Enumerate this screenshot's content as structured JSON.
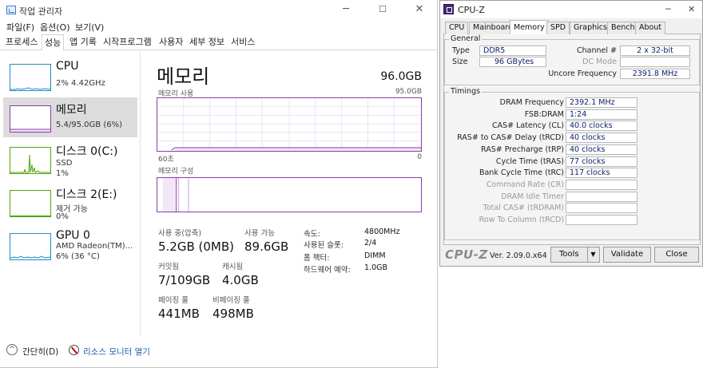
{
  "taskmgr": {
    "title": "작업 관리자",
    "window_controls": [
      "─",
      "☐",
      "✕"
    ],
    "menu": [
      "파일(F)",
      "옵션(O)",
      "보기(V)"
    ],
    "tabs": [
      "프로세스",
      "성능",
      "앱 기록",
      "시작프로그램",
      "사용자",
      "세부 정보",
      "서비스"
    ],
    "active_tab": "성능",
    "sidebar": [
      {
        "name": "CPU",
        "sub1": "2% 4.42GHz",
        "color": "#1e8bc3"
      },
      {
        "name": "메모리",
        "sub1": "5.4/95.0GB (6%)",
        "color": "#8b3ca8"
      },
      {
        "name": "디스크 0(C:)",
        "sub1": "SSD",
        "sub2": "1%",
        "color": "#4da60c"
      },
      {
        "name": "디스크 2(E:)",
        "sub1": "제거 가능",
        "sub2": "0%",
        "color": "#4da60c"
      },
      {
        "name": "GPU 0",
        "sub1": "AMD Radeon(TM)...",
        "sub2": "6% (36 °C)",
        "color": "#1e8bc3"
      }
    ],
    "main": {
      "title": "메모리",
      "total": "96.0GB",
      "usage_label": "메모리 사용",
      "usage_max": "95.0GB",
      "time_label": "60초",
      "zero": "0",
      "composition_label": "메모리 구성",
      "usage_fraction": 0.06,
      "stats": {
        "in_use_label": "사용 중(압축)",
        "in_use_value": "5.2GB (0MB)",
        "available_label": "사용 가능",
        "available_value": "89.6GB",
        "committed_label": "커밋됨",
        "committed_value": "7/109GB",
        "cached_label": "캐시됨",
        "cached_value": "4.0GB",
        "paged_label": "페이징 풀",
        "paged_value": "441MB",
        "nonpaged_label": "비페이징 풀",
        "nonpaged_value": "498MB"
      },
      "details": [
        {
          "label": "속도:",
          "value": "4800MHz"
        },
        {
          "label": "사용된 슬롯:",
          "value": "2/4"
        },
        {
          "label": "폼 팩터:",
          "value": "DIMM"
        },
        {
          "label": "하드웨어 예약:",
          "value": "1.0GB"
        }
      ]
    },
    "footer": {
      "less": "간단히(D)",
      "monitor": "리소스 모니터 열기"
    }
  },
  "cpuz": {
    "title": "CPU-Z",
    "window_controls": [
      "─",
      "✕"
    ],
    "tabs": [
      "CPU",
      "Mainboard",
      "Memory",
      "SPD",
      "Graphics",
      "Bench",
      "About"
    ],
    "active_tab": "Memory",
    "general": {
      "title": "General",
      "type_label": "Type",
      "type_value": "DDR5",
      "size_label": "Size",
      "size_value": "96 GBytes",
      "channel_label": "Channel #",
      "channel_value": "2 x 32-bit",
      "dcmode_label": "DC Mode",
      "dcmode_value": "",
      "uncore_label": "Uncore Frequency",
      "uncore_value": "2391.8 MHz"
    },
    "timings": {
      "title": "Timings",
      "rows": [
        {
          "label": "DRAM Frequency",
          "value": "2392.1 MHz",
          "enabled": true
        },
        {
          "label": "FSB:DRAM",
          "value": "1:24",
          "enabled": true
        },
        {
          "label": "CAS# Latency (CL)",
          "value": "40.0 clocks",
          "enabled": true
        },
        {
          "label": "RAS# to CAS# Delay (tRCD)",
          "value": "40 clocks",
          "enabled": true
        },
        {
          "label": "RAS# Precharge (tRP)",
          "value": "40 clocks",
          "enabled": true
        },
        {
          "label": "Cycle Time (tRAS)",
          "value": "77 clocks",
          "enabled": true
        },
        {
          "label": "Bank Cycle Time (tRC)",
          "value": "117 clocks",
          "enabled": true
        },
        {
          "label": "Command Rate (CR)",
          "value": "",
          "enabled": false
        },
        {
          "label": "DRAM Idle Timer",
          "value": "",
          "enabled": false
        },
        {
          "label": "Total CAS# (tRDRAM)",
          "value": "",
          "enabled": false
        },
        {
          "label": "Row To Column (tRCD)",
          "value": "",
          "enabled": false
        }
      ]
    },
    "bottom": {
      "brand": "CPU-Z",
      "version": "Ver. 2.09.0.x64",
      "tools": "Tools",
      "tools_arrow": "▼",
      "validate": "Validate",
      "close": "Close"
    }
  }
}
